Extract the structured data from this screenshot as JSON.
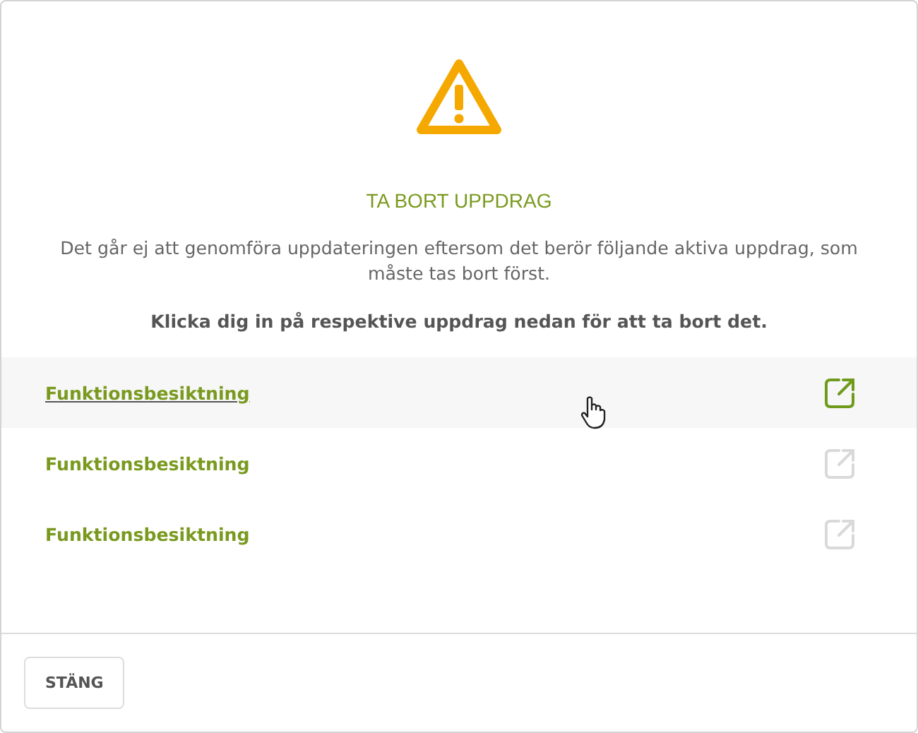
{
  "dialog": {
    "title": "TA BORT UPPDRAG",
    "message": "Det går ej att genomföra uppdateringen eftersom det berör följande aktiva uppdrag, som måste tas bort först.",
    "instruction": "Klicka dig in på respektive uppdrag nedan för att ta bort det.",
    "items": [
      {
        "label": "Funktionsbesiktning",
        "hovered": true
      },
      {
        "label": "Funktionsbesiktning",
        "hovered": false
      },
      {
        "label": "Funktionsbesiktning",
        "hovered": false
      }
    ],
    "buttons": [
      {
        "label": "STÄNG"
      }
    ]
  }
}
